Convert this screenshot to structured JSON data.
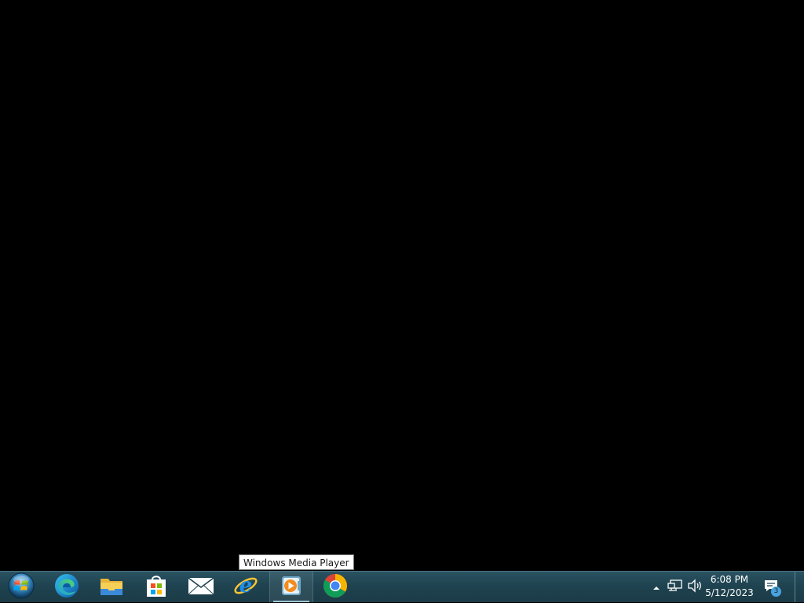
{
  "tooltip": {
    "text": "Windows Media Player"
  },
  "taskbar": {
    "start_button": {
      "icon": "windows-start-orb-icon"
    },
    "pinned": [
      {
        "name": "Microsoft Edge",
        "icon": "edge-icon"
      },
      {
        "name": "File Explorer",
        "icon": "folder-icon"
      },
      {
        "name": "Microsoft Store",
        "icon": "store-bag-icon"
      },
      {
        "name": "Mail",
        "icon": "mail-envelope-icon"
      },
      {
        "name": "Internet Explorer",
        "icon": "internet-explorer-icon"
      },
      {
        "name": "Windows Media Player",
        "icon": "media-player-icon",
        "hovered": true
      },
      {
        "name": "Google Chrome",
        "icon": "chrome-icon"
      }
    ]
  },
  "tray": {
    "overflow_icon": "chevron-up-icon",
    "network_icon": "network-icon",
    "volume_icon": "speaker-icon",
    "clock": {
      "time": "6:08 PM",
      "date": "5/12/2023"
    },
    "notifications": {
      "icon": "action-center-icon",
      "count": "3"
    }
  },
  "colors": {
    "desktop": "#000000",
    "taskbar": "#1f4350",
    "accent": "#4aa3df"
  }
}
